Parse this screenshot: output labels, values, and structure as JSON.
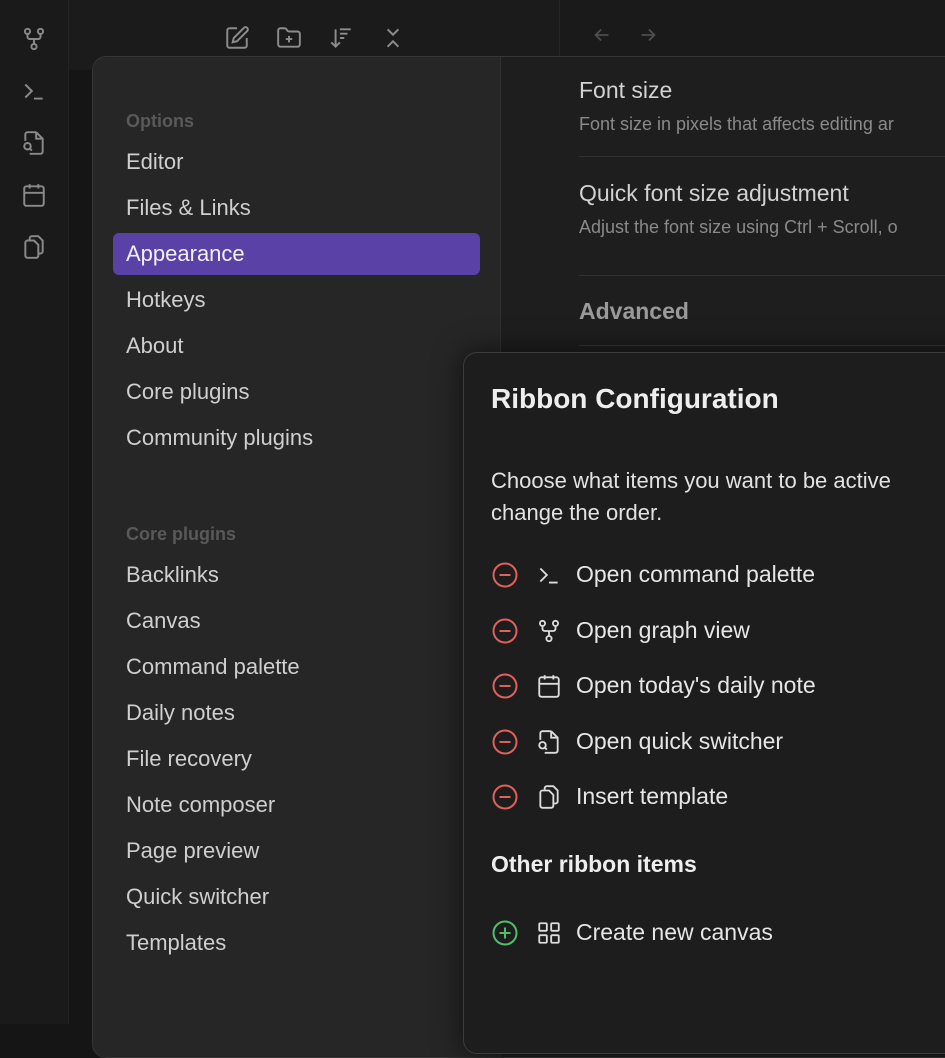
{
  "settings": {
    "sections": [
      {
        "heading": "Options",
        "items": [
          "Editor",
          "Files & Links",
          "Appearance",
          "Hotkeys",
          "About",
          "Core plugins",
          "Community plugins"
        ]
      },
      {
        "heading": "Core plugins",
        "items": [
          "Backlinks",
          "Canvas",
          "Command palette",
          "Daily notes",
          "File recovery",
          "Note composer",
          "Page preview",
          "Quick switcher",
          "Templates"
        ]
      }
    ],
    "active_item": "Appearance",
    "content": {
      "font_size": {
        "name": "Font size",
        "desc": "Font size in pixels that affects editing ar"
      },
      "quick_font": {
        "name": "Quick font size adjustment",
        "desc": "Adjust the font size using Ctrl + Scroll, o"
      },
      "advanced_heading": "Advanced"
    }
  },
  "modal": {
    "title": "Ribbon Configuration",
    "desc_line1": "Choose what items you want to be active",
    "desc_line2": "change the order.",
    "active_items": [
      {
        "label": "Open command palette",
        "icon": "terminal-icon"
      },
      {
        "label": "Open graph view",
        "icon": "graph-icon"
      },
      {
        "label": "Open today's daily note",
        "icon": "calendar-icon"
      },
      {
        "label": "Open quick switcher",
        "icon": "file-search-icon"
      },
      {
        "label": "Insert template",
        "icon": "copy-icon"
      }
    ],
    "other_heading": "Other ribbon items",
    "other_items": [
      {
        "label": "Create new canvas",
        "icon": "layout-grid-icon"
      }
    ]
  },
  "colors": {
    "accent": "#5a41a6",
    "remove": "#e0605c",
    "add": "#4fbf6a"
  }
}
